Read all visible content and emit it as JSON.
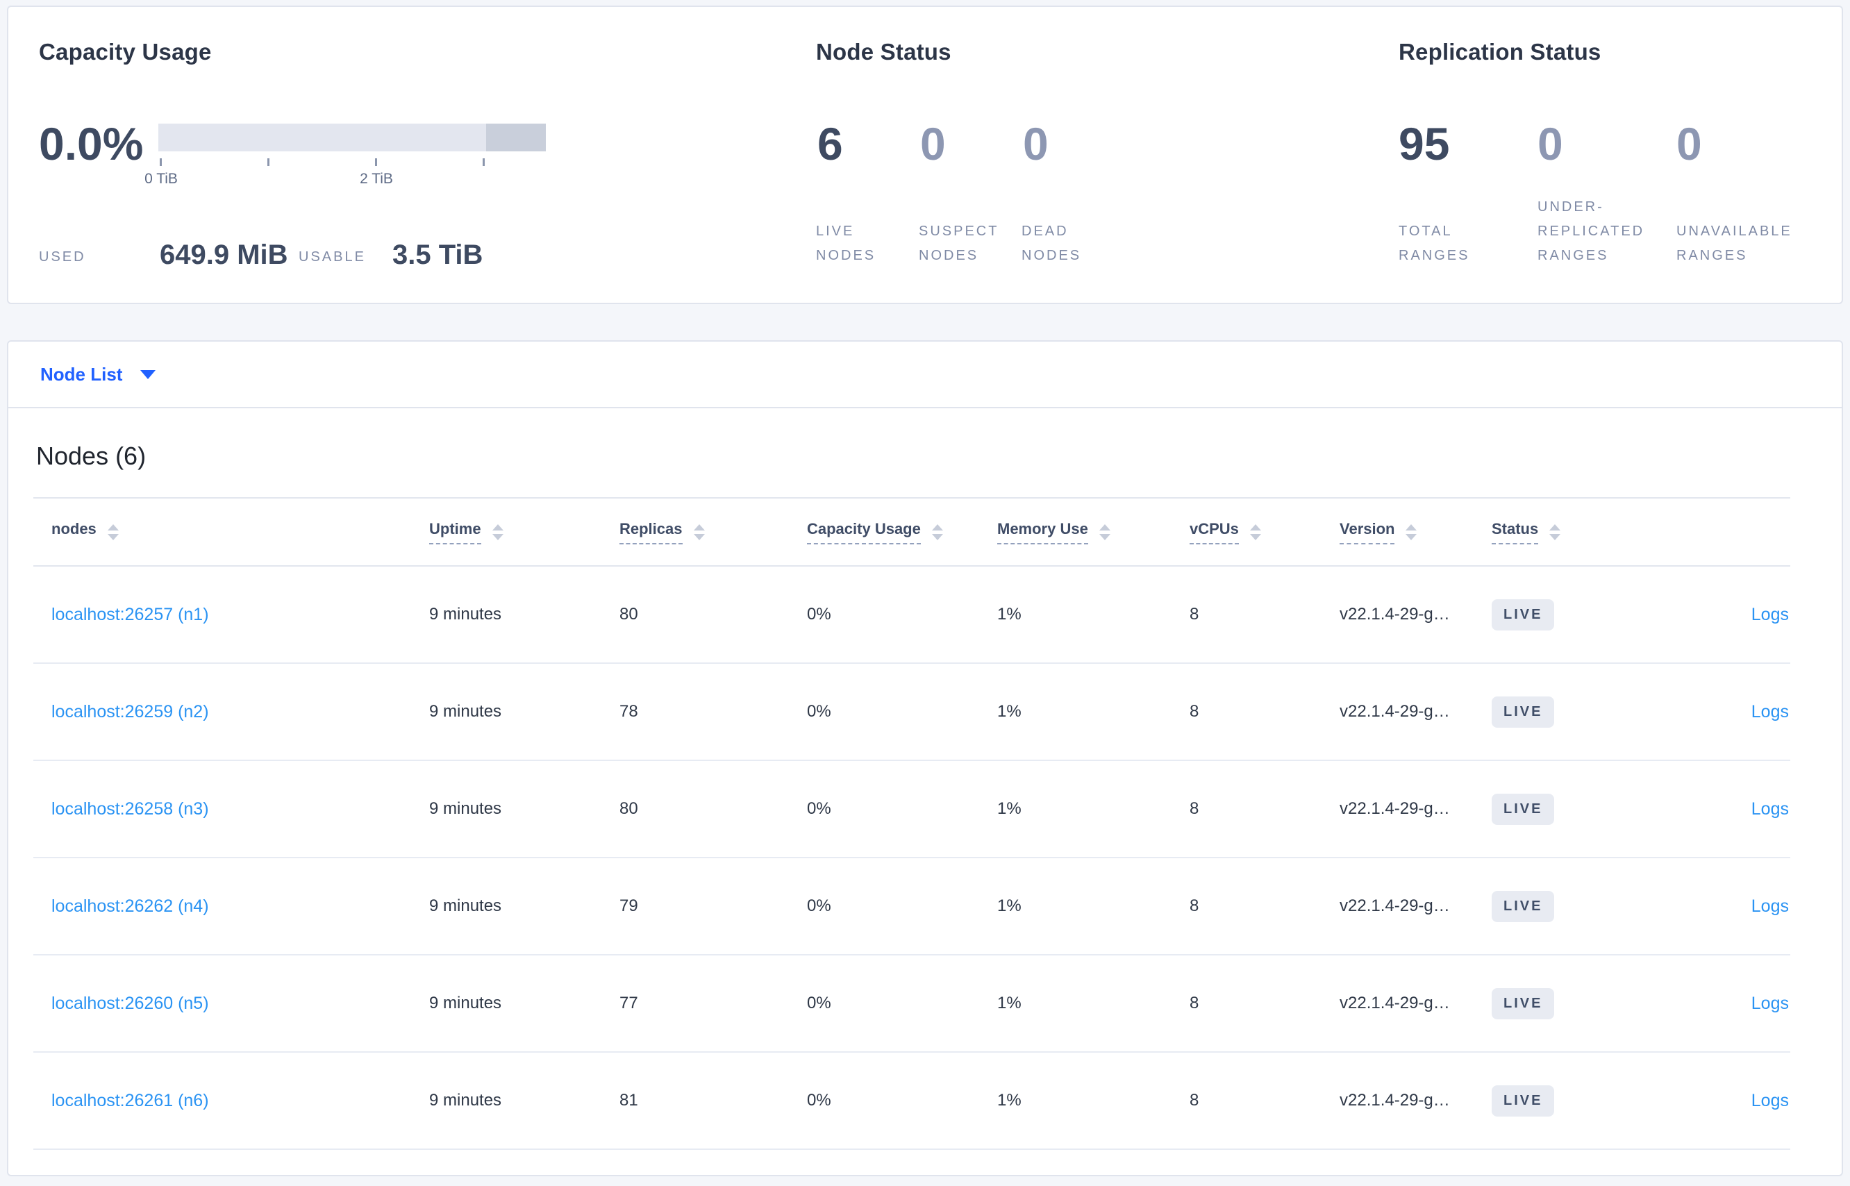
{
  "colors": {
    "page_background": "#f4f6fa",
    "card_border": "#e0e4ed",
    "accent_blue": "#2161ff",
    "link_blue": "#2a93f3",
    "number_dark": "#3e4a61",
    "number_muted": "#8d97b2",
    "label_gray": "#7f8aa5",
    "bar_light": "#e3e6ef",
    "bar_dark": "#c9cfdb",
    "badge_background": "#e8ebf2",
    "badge_text": "#404e68"
  },
  "summary": {
    "capacity": {
      "title": "Capacity Usage",
      "percent": "0.0%",
      "tick_labels": [
        "0 TiB",
        "2 TiB"
      ],
      "used_label": "USED",
      "used_value": "649.9 MiB",
      "usable_label": "USABLE",
      "usable_value": "3.5 TiB"
    },
    "node_status": {
      "title": "Node Status",
      "stats": [
        {
          "value": "6",
          "muted": false,
          "label": [
            "LIVE",
            "NODES"
          ]
        },
        {
          "value": "0",
          "muted": true,
          "label": [
            "SUSPECT",
            "NODES"
          ]
        },
        {
          "value": "0",
          "muted": true,
          "label": [
            "DEAD",
            "NODES"
          ]
        }
      ]
    },
    "replication": {
      "title": "Replication Status",
      "stats": [
        {
          "value": "95",
          "muted": false,
          "label": [
            "TOTAL",
            "RANGES"
          ]
        },
        {
          "value": "0",
          "muted": true,
          "label": [
            "UNDER-",
            "REPLICATED",
            "RANGES"
          ]
        },
        {
          "value": "0",
          "muted": true,
          "label": [
            "UNAVAILABLE",
            "RANGES"
          ]
        }
      ]
    }
  },
  "node_list": {
    "label": "Node List"
  },
  "nodes_table": {
    "title": "Nodes (6)",
    "columns": [
      {
        "label": "nodes"
      },
      {
        "label": "Uptime"
      },
      {
        "label": "Replicas"
      },
      {
        "label": "Capacity Usage"
      },
      {
        "label": "Memory Use"
      },
      {
        "label": "vCPUs"
      },
      {
        "label": "Version"
      },
      {
        "label": "Status"
      }
    ],
    "rows": [
      {
        "address": "localhost:26257 (n1)",
        "uptime": "9 minutes",
        "replicas": "80",
        "capacity": "0%",
        "memory": "1%",
        "vcpus": "8",
        "version": "v22.1.4-29-g…",
        "status": "LIVE",
        "logs": "Logs"
      },
      {
        "address": "localhost:26259 (n2)",
        "uptime": "9 minutes",
        "replicas": "78",
        "capacity": "0%",
        "memory": "1%",
        "vcpus": "8",
        "version": "v22.1.4-29-g…",
        "status": "LIVE",
        "logs": "Logs"
      },
      {
        "address": "localhost:26258 (n3)",
        "uptime": "9 minutes",
        "replicas": "80",
        "capacity": "0%",
        "memory": "1%",
        "vcpus": "8",
        "version": "v22.1.4-29-g…",
        "status": "LIVE",
        "logs": "Logs"
      },
      {
        "address": "localhost:26262 (n4)",
        "uptime": "9 minutes",
        "replicas": "79",
        "capacity": "0%",
        "memory": "1%",
        "vcpus": "8",
        "version": "v22.1.4-29-g…",
        "status": "LIVE",
        "logs": "Logs"
      },
      {
        "address": "localhost:26260 (n5)",
        "uptime": "9 minutes",
        "replicas": "77",
        "capacity": "0%",
        "memory": "1%",
        "vcpus": "8",
        "version": "v22.1.4-29-g…",
        "status": "LIVE",
        "logs": "Logs"
      },
      {
        "address": "localhost:26261 (n6)",
        "uptime": "9 minutes",
        "replicas": "81",
        "capacity": "0%",
        "memory": "1%",
        "vcpus": "8",
        "version": "v22.1.4-29-g…",
        "status": "LIVE",
        "logs": "Logs"
      }
    ]
  }
}
